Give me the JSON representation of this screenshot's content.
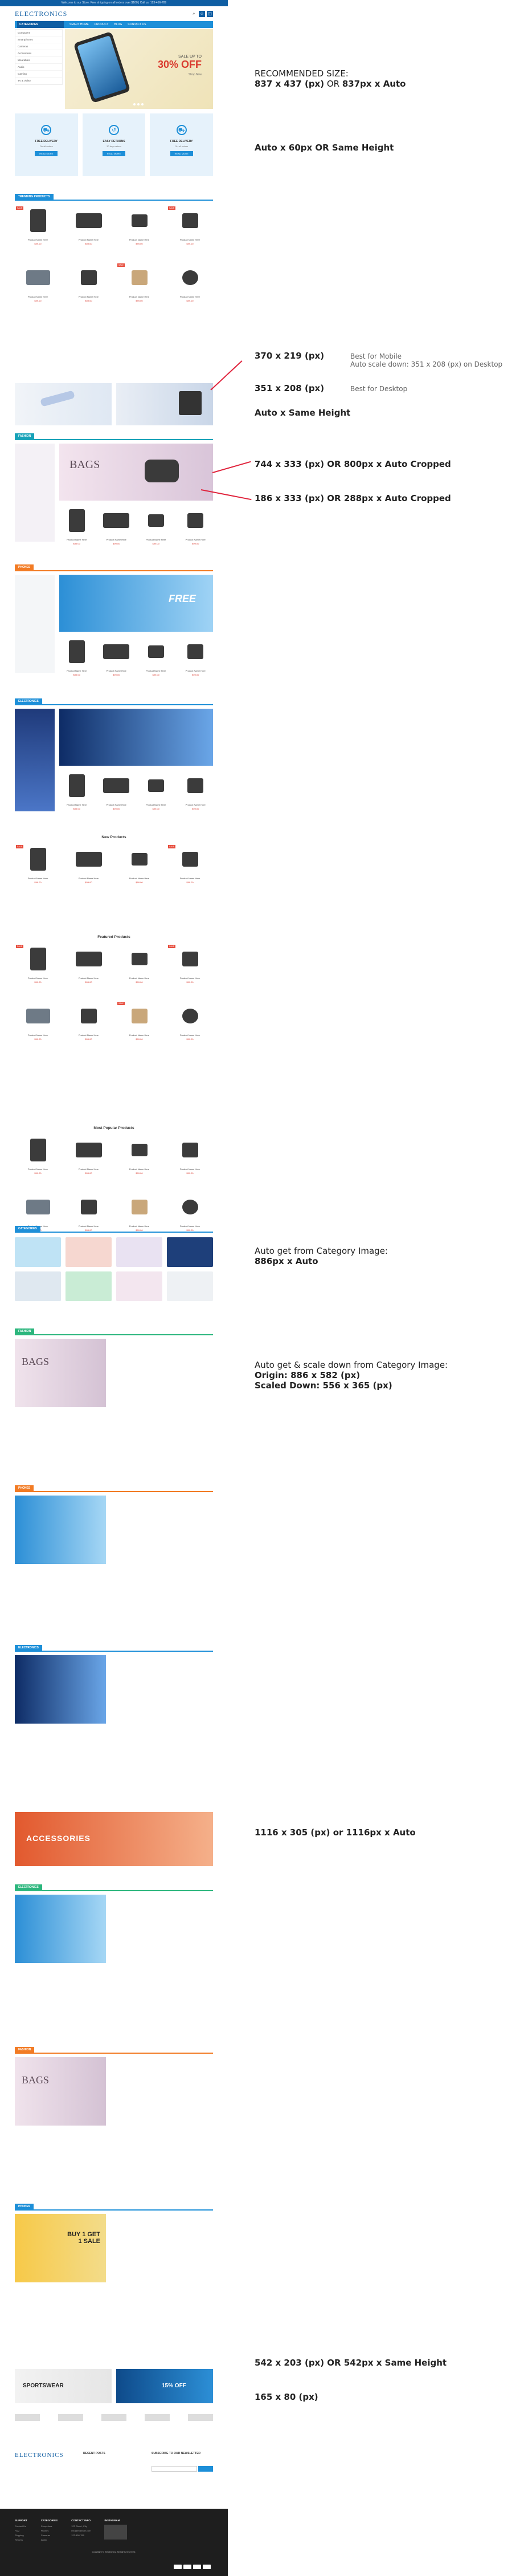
{
  "store": {
    "topbar_text": "Welcome to our Store. Free shipping on all orders over $100 | Call us: 123-456-789",
    "logo": "ELECTRONICS",
    "nav": {
      "categories_label": "CATEGORIES",
      "items": [
        "SMART HOME",
        "PRODUCT",
        "BLOG",
        "CONTACT US"
      ]
    },
    "sidebar_categories": [
      "Computers",
      "Smartphones",
      "Cameras",
      "Accessories",
      "Wearables",
      "Audio",
      "Gaming",
      "TV & Video"
    ],
    "slider": {
      "title": "SALE UP TO",
      "discount": "30% OFF",
      "cta": "Shop Now"
    },
    "features": [
      {
        "icon": "truck-icon",
        "title": "FREE DELIVERY",
        "desc": "On all orders",
        "btn": "READ MORE"
      },
      {
        "icon": "return-icon",
        "title": "EASY RETURNS",
        "desc": "30 days return",
        "btn": "READ MORE"
      },
      {
        "icon": "truck-icon",
        "title": "FREE DELIVERY",
        "desc": "On all orders",
        "btn": "READ MORE"
      }
    ],
    "section_tags": {
      "trending": "TRENDING PRODUCTS",
      "fashion": "FASHION",
      "phones": "PHONES",
      "electronics": "ELECTRONICS",
      "categories": "CATEGORIES",
      "new": "New Products",
      "featured": "Featured Products",
      "popular": "Most Popular Products"
    },
    "product_name": "Product Name Here",
    "product_price": "$99.00",
    "sale_badge": "SALE",
    "bags_title": "BAGS",
    "free_title": "FREE",
    "accessories_title": "ACCESSORIES",
    "buy_title": "BUY 1 GET 1 SALE",
    "sportswear_title": "SPORTSWEAR",
    "offer_15": "15% OFF",
    "footer": {
      "newsletter_title": "SUBSCRIBE TO OUR NEWSLETTER",
      "recent_posts": "RECENT POSTS",
      "cols": [
        {
          "h": "SUPPORT",
          "links": [
            "Contact Us",
            "FAQ",
            "Shipping",
            "Returns"
          ]
        },
        {
          "h": "CATEGORIES",
          "links": [
            "Computers",
            "Phones",
            "Cameras",
            "Audio"
          ]
        },
        {
          "h": "CONTACT INFO",
          "links": [
            "123 Street, City",
            "info@example.com",
            "123-456-789"
          ]
        },
        {
          "h": "INSTAGRAM",
          "links": []
        }
      ],
      "copyright": "Copyright © Electronics. All rights reserved."
    }
  },
  "annotations": [
    {
      "line1": "RECOMMENDED SIZE:",
      "line2_bold1": "837 x 437 (px)",
      "line2_mid": " OR ",
      "line2_bold2": "837px x Auto"
    },
    {
      "line1": "Auto x 60px OR Same Height"
    },
    {
      "line1": "370 x 219 (px)",
      "aside1": "Best for Mobile",
      "aside2": "Auto scale down: 351 x 208 (px) on Desktop"
    },
    {
      "line1": "351 x 208 (px)",
      "aside1": "Best for Desktop"
    },
    {
      "line1": "Auto x Same Height"
    },
    {
      "line1": "744 x 333 (px) OR 800px x Auto Cropped"
    },
    {
      "line1": "186 x 333 (px) OR 288px x Auto Cropped"
    },
    {
      "line1": "Auto get from Category Image:",
      "line2": "886px x Auto"
    },
    {
      "line1": "Auto get & scale down from Category Image:",
      "line2": "Origin: 886 x 582 (px)",
      "line3": "Scaled Down: 556 x 365 (px)"
    },
    {
      "line1": "1116 x 305 (px) or 1116px x Auto"
    },
    {
      "line1": "542 x 203 (px) OR 542px x Same Height"
    },
    {
      "line1": "165 x 80 (px)"
    }
  ],
  "colors": {
    "brand": "#0f5ea3",
    "accent": "#1d8fd8",
    "pointer": "#e0243d"
  }
}
